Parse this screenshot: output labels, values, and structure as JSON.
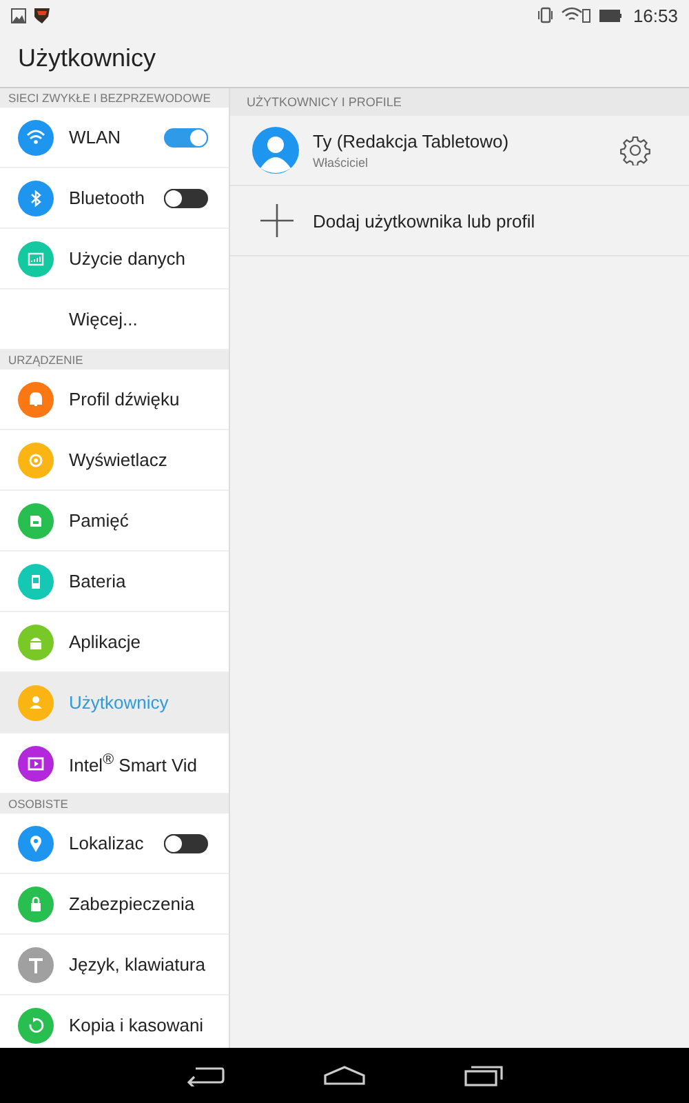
{
  "status_bar": {
    "time": "16:53"
  },
  "title": "Użytkownicy",
  "sidebar": {
    "sections": [
      {
        "header": "SIECI ZWYKŁE I BEZPRZEWODOWE",
        "items": [
          {
            "label": "WLAN",
            "kind": "toggle",
            "on": true,
            "color": "#1e96f0",
            "selected": false
          },
          {
            "label": "Bluetooth",
            "kind": "toggle",
            "on": false,
            "color": "#1e96f0",
            "selected": false
          },
          {
            "label": "Użycie danych",
            "kind": "plain",
            "color": "#14c8a0",
            "selected": false
          },
          {
            "label": "Więcej...",
            "kind": "text",
            "selected": false
          }
        ]
      },
      {
        "header": "URZĄDZENIE",
        "items": [
          {
            "label": "Profil dźwięku",
            "kind": "plain",
            "color": "#fa7814",
            "selected": false
          },
          {
            "label": "Wyświetlacz",
            "kind": "plain",
            "color": "#fab414",
            "selected": false
          },
          {
            "label": "Pamięć",
            "kind": "plain",
            "color": "#28be50",
            "selected": false
          },
          {
            "label": "Bateria",
            "kind": "plain",
            "color": "#14c8b4",
            "selected": false
          },
          {
            "label": "Aplikacje",
            "kind": "plain",
            "color": "#78c828",
            "selected": false
          },
          {
            "label": "Użytkownicy",
            "kind": "plain",
            "color": "#fab414",
            "selected": true
          },
          {
            "label": "Intel$^{®}$ Smart Vid",
            "kind": "plain",
            "color": "#b428dc",
            "selected": false
          }
        ]
      },
      {
        "header": "OSOBISTE",
        "items": [
          {
            "label": "Lokalizac",
            "kind": "toggle",
            "on": false,
            "color": "#1e96f0",
            "selected": false
          },
          {
            "label": "Zabezpieczenia",
            "kind": "plain",
            "color": "#28be50",
            "selected": false
          },
          {
            "label": "Język, klawiatura",
            "kind": "plain",
            "color": "#a0a0a0",
            "selected": false
          },
          {
            "label": "Kopia i kasowani",
            "kind": "plain",
            "color": "#28be50",
            "selected": false
          }
        ]
      }
    ]
  },
  "panel": {
    "header": "UŻYTKOWNICY I PROFILE",
    "users": [
      {
        "name": "Ty (Redakcja Tabletowo)",
        "role": "Właściciel"
      }
    ],
    "add_label": "Dodaj użytkownika lub profil"
  }
}
